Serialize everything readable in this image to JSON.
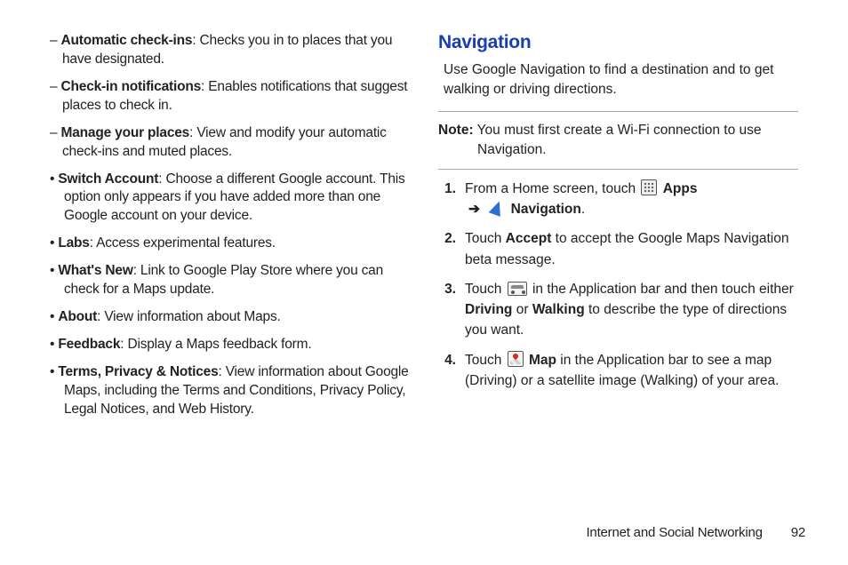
{
  "left": {
    "dash": [
      {
        "term": "Automatic check-ins",
        "desc": ": Checks you in to places that you have designated."
      },
      {
        "term": "Check-in notifications",
        "desc": ": Enables notifications that suggest places to check in."
      },
      {
        "term": "Manage your places",
        "desc": ": View and modify your automatic check-ins and muted places."
      }
    ],
    "bullets": [
      {
        "term": "Switch Account",
        "desc": ": Choose a different Google account. This option only appears if you have added more than one Google account on your device."
      },
      {
        "term": "Labs",
        "desc": ": Access experimental features."
      },
      {
        "term": "What's New",
        "desc": ": Link to Google Play Store where you can check for a Maps update."
      },
      {
        "term": "About",
        "desc": ": View information about Maps."
      },
      {
        "term": "Feedback",
        "desc": ": Display a Maps feedback form."
      },
      {
        "term": "Terms, Privacy & Notices",
        "desc": ": View information about Google Maps, including the Terms and Conditions, Privacy Policy, Legal Notices, and Web History."
      }
    ]
  },
  "right": {
    "heading": "Navigation",
    "intro": "Use Google Navigation to find a destination and to get walking or driving directions.",
    "note_label": "Note:",
    "note_text": " You must first create a Wi-Fi connection to use Navigation.",
    "steps": {
      "s1_a": "From a Home screen, touch ",
      "s1_apps": " Apps",
      "s1_arrow": "➔",
      "s1_nav": " Navigation",
      "s1_end": ".",
      "s2_a": "Touch ",
      "s2_accept": "Accept",
      "s2_b": " to accept the Google Maps Navigation beta message.",
      "s3_a": "Touch ",
      "s3_b": " in the Application bar and then touch either ",
      "s3_driving": "Driving",
      "s3_or": " or ",
      "s3_walking": "Walking",
      "s3_c": " to describe the type of directions you want.",
      "s4_a": "Touch ",
      "s4_map": " Map",
      "s4_b": " in the Application bar to see a map (Driving) or a satellite image (Walking) of your area."
    }
  },
  "footer": {
    "section": "Internet and Social Networking",
    "page": "92"
  }
}
